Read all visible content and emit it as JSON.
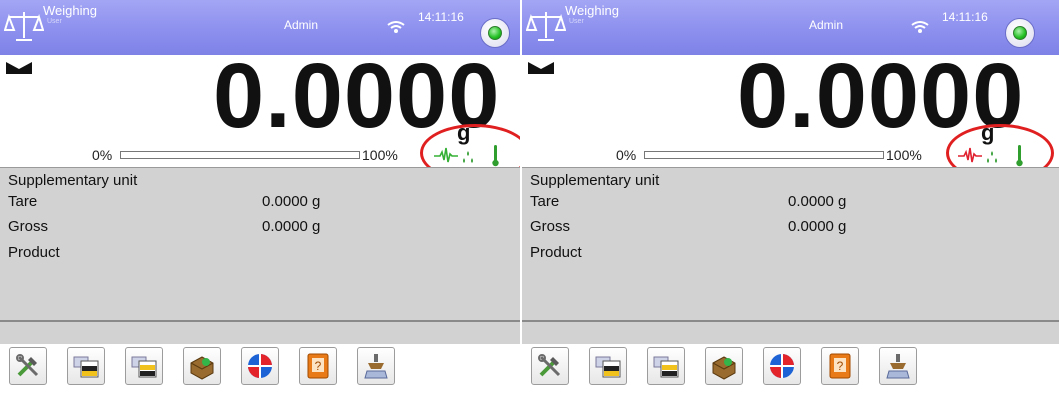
{
  "colors": {
    "topbar": "#8d90ee",
    "info_background": "#d2d2d2",
    "highlight_ring": "#e02020",
    "stability_left": "#35b035",
    "stability_right": "#e0202f",
    "status_led": "#22c022"
  },
  "panels": [
    {
      "header": {
        "app_title": "Weighing",
        "app_subtitle": "User",
        "user": "Admin",
        "clock": "14:11:16",
        "icons": [
          "balance-icon",
          "wifi-icon",
          "status-led-icon"
        ]
      },
      "display": {
        "weight": "0.0000",
        "unit": "g",
        "bar_min": "0%",
        "bar_max": "100%",
        "bar_fill_fraction": 0,
        "stable_indicator": "stable-icon",
        "status_icons": [
          "stability-pulse-icon",
          "humidity-drops-icon",
          "thermometer-icon"
        ],
        "stability_pulse_color": "green"
      },
      "info": {
        "rows": [
          {
            "label": "Supplementary unit",
            "value": ""
          },
          {
            "label": "Tare",
            "value": "0.0000 g"
          },
          {
            "label": "Gross",
            "value": "0.0000 g"
          },
          {
            "label": "Product",
            "value": ""
          }
        ]
      },
      "softkeys": [
        "tools-icon",
        "print-header-icon",
        "print-footer-icon",
        "product-icon",
        "calibration-icon",
        "help-icon",
        "weighing-icon"
      ]
    },
    {
      "header": {
        "app_title": "Weighing",
        "app_subtitle": "User",
        "user": "Admin",
        "clock": "14:11:16",
        "icons": [
          "balance-icon",
          "wifi-icon",
          "status-led-icon"
        ]
      },
      "display": {
        "weight": "0.0000",
        "unit": "g",
        "bar_min": "0%",
        "bar_max": "100%",
        "bar_fill_fraction": 0,
        "stable_indicator": "stable-icon",
        "status_icons": [
          "stability-pulse-icon",
          "humidity-drops-icon",
          "thermometer-icon"
        ],
        "stability_pulse_color": "red"
      },
      "info": {
        "rows": [
          {
            "label": "Supplementary unit",
            "value": ""
          },
          {
            "label": "Tare",
            "value": "0.0000 g"
          },
          {
            "label": "Gross",
            "value": "0.0000 g"
          },
          {
            "label": "Product",
            "value": ""
          }
        ]
      },
      "softkeys": [
        "tools-icon",
        "print-header-icon",
        "print-footer-icon",
        "product-icon",
        "calibration-icon",
        "help-icon",
        "weighing-icon"
      ]
    }
  ]
}
